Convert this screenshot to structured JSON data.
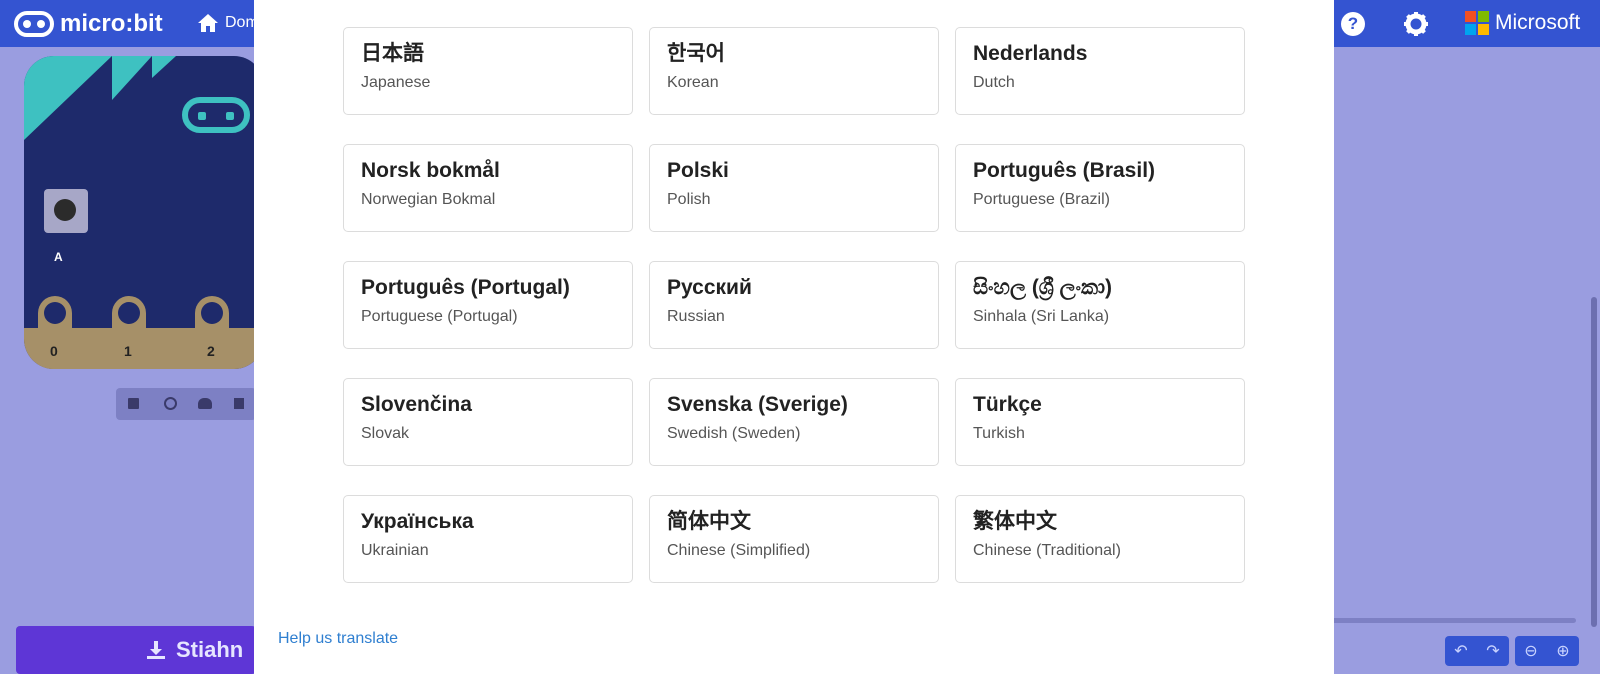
{
  "header": {
    "logo_text": "micro:bit",
    "home_label": "Dom",
    "help_glyph": "?",
    "brand_text": "Microsoft",
    "brand_colors": [
      "#f25022",
      "#7fba00",
      "#00a4ef",
      "#ffb900"
    ]
  },
  "simulator": {
    "button_label": "A",
    "pins": [
      "0",
      "1",
      "2"
    ]
  },
  "download": {
    "label": "Stiahn"
  },
  "language_dialog": {
    "languages": [
      {
        "native": "日本語",
        "english": "Japanese"
      },
      {
        "native": "한국어",
        "english": "Korean"
      },
      {
        "native": "Nederlands",
        "english": "Dutch"
      },
      {
        "native": "Norsk bokmål",
        "english": "Norwegian Bokmal"
      },
      {
        "native": "Polski",
        "english": "Polish"
      },
      {
        "native": "Português (Brasil)",
        "english": "Portuguese (Brazil)"
      },
      {
        "native": "Português (Portugal)",
        "english": "Portuguese (Portugal)"
      },
      {
        "native": "Русский",
        "english": "Russian"
      },
      {
        "native": "සිංහල (ශ්‍රී ලංකා)",
        "english": "Sinhala (Sri Lanka)"
      },
      {
        "native": "Slovenčina",
        "english": "Slovak"
      },
      {
        "native": "Svenska (Sverige)",
        "english": "Swedish (Sweden)"
      },
      {
        "native": "Türkçe",
        "english": "Turkish"
      },
      {
        "native": "Українська",
        "english": "Ukrainian"
      },
      {
        "native": "简体中文",
        "english": "Chinese (Simplified)"
      },
      {
        "native": "繁体中文",
        "english": "Chinese (Traditional)"
      }
    ],
    "help_link": "Help us translate"
  },
  "colors": {
    "header_blue": "#3454d1",
    "link_blue": "#2f7fd0",
    "download_purple": "#5e36d6"
  }
}
